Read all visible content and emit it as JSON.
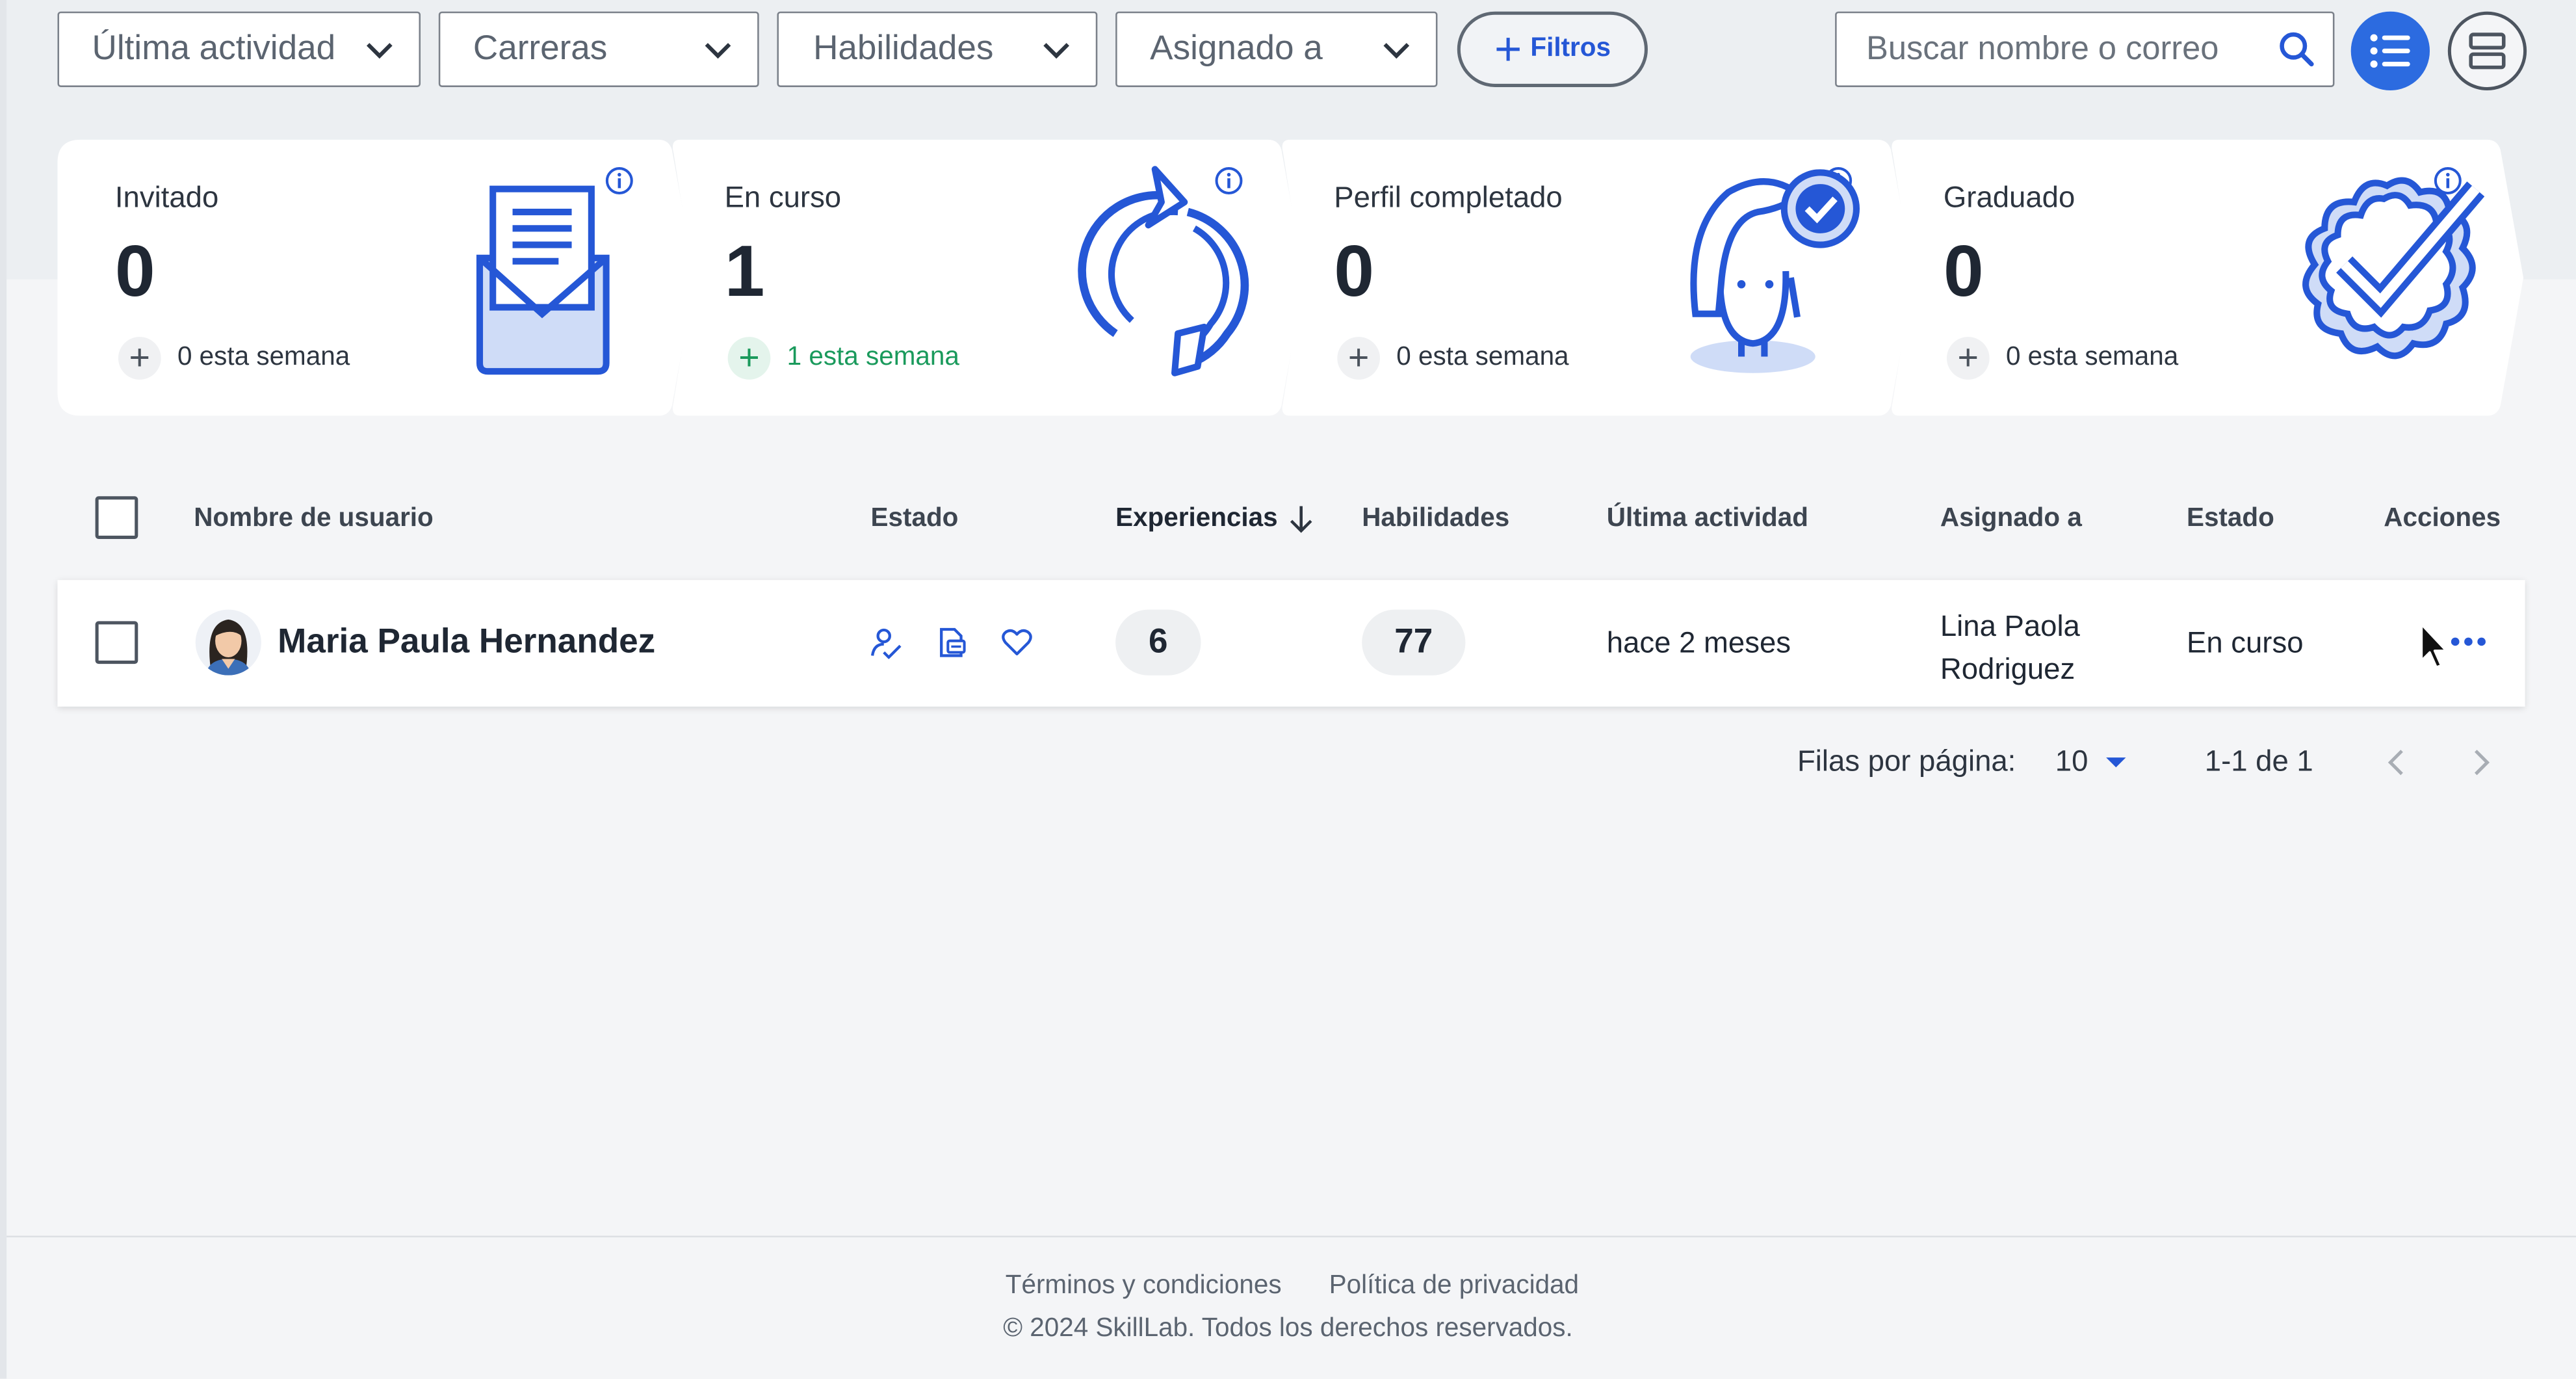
{
  "filters": {
    "last_activity": "Última actividad",
    "careers": "Carreras",
    "skills": "Habilidades",
    "assigned_to": "Asignado a",
    "filters_button": "Filtros",
    "search_placeholder": "Buscar nombre o correo"
  },
  "view": {
    "active": "list-view",
    "inactive": "card-view"
  },
  "stats": [
    {
      "label": "Invitado",
      "count": "0",
      "week": "0 esta semana",
      "icon": "envelope-document-icon"
    },
    {
      "label": "En curso",
      "count": "1",
      "week": "1 esta semana",
      "icon": "refresh-cycle-icon",
      "highlight": true
    },
    {
      "label": "Perfil completado",
      "count": "0",
      "week": "0 esta semana",
      "icon": "person-check-icon"
    },
    {
      "label": "Graduado",
      "count": "0",
      "week": "0 esta semana",
      "icon": "badge-check-icon"
    }
  ],
  "table": {
    "headers": {
      "username": "Nombre de usuario",
      "status": "Estado",
      "experiences": "Experiencias",
      "skills": "Habilidades",
      "last_activity": "Última actividad",
      "assigned_to": "Asignado a",
      "state": "Estado",
      "actions": "Acciones"
    },
    "sorted_column": "experiences",
    "sort_direction": "descending",
    "rows": [
      {
        "name": "Maria Paula Hernandez",
        "experiences": "6",
        "skills": "77",
        "last_activity": "hace 2 meses",
        "assigned_to_line1": "Lina Paola",
        "assigned_to_line2": "Rodriguez",
        "state": "En curso"
      }
    ]
  },
  "pagination": {
    "rows_label": "Filas por página:",
    "rows_value": "10",
    "range": "1-1 de 1"
  },
  "footer": {
    "terms": "Términos y condiciones",
    "privacy": "Política de privacidad",
    "copyright": "© 2024 SkillLab. Todos los derechos reservados."
  },
  "colors": {
    "accent": "#2c6be0",
    "success": "#1a9a5c",
    "text": "#1f2733",
    "background": "#f4f5f7"
  }
}
